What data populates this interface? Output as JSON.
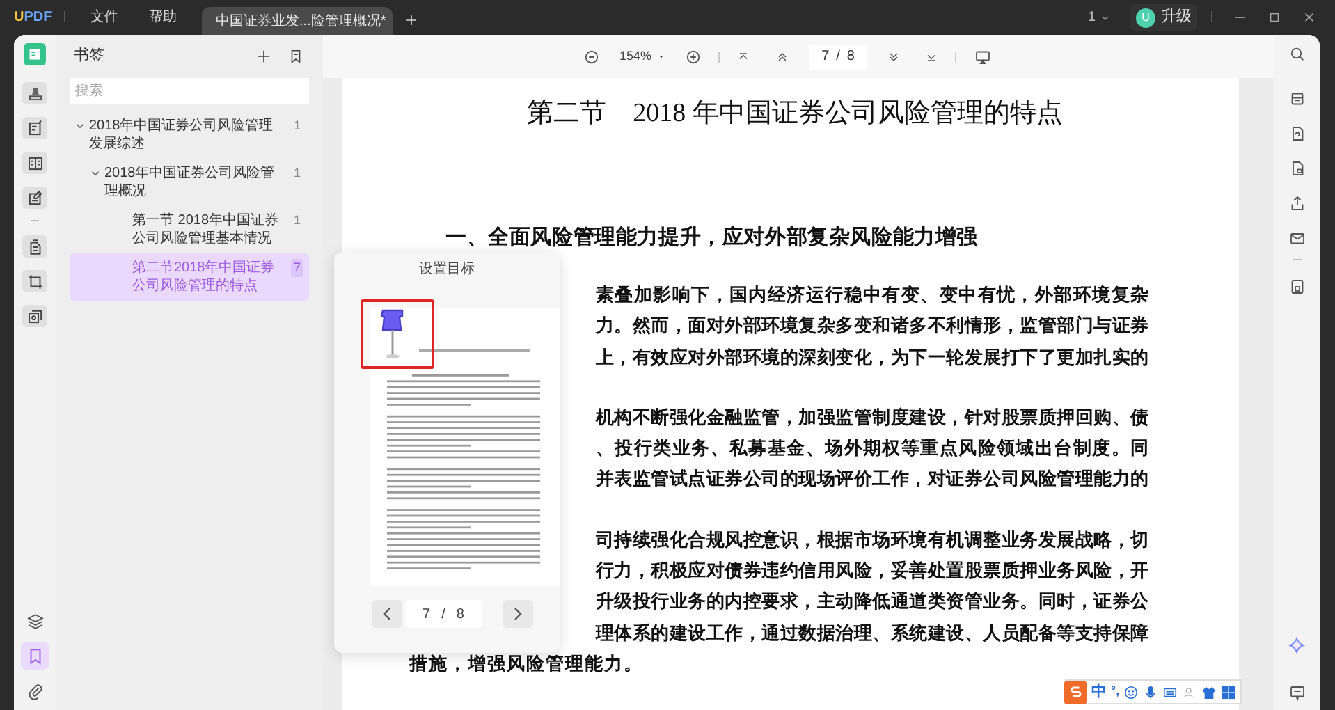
{
  "app": {
    "logo": "UPDF",
    "menu": [
      {
        "label": "文件"
      },
      {
        "label": "帮助"
      }
    ]
  },
  "tabs": [
    {
      "title": "中国证券业发...险管理概况*",
      "selected": true
    }
  ],
  "window_controls": {
    "page_count": "1",
    "upgrade": {
      "avatar": "U",
      "label": "升级"
    }
  },
  "toolbar": {
    "zoom": "154%",
    "page": {
      "current": "7",
      "separator": "/",
      "total": "8"
    }
  },
  "left_tools": [
    {
      "selected": false
    },
    {
      "selected": false
    },
    {
      "selected": false
    },
    {
      "selected": false
    },
    {
      "selected": false
    },
    {
      "selected": false
    },
    {
      "selected": false
    }
  ],
  "left_tools_bottom": [
    {
      "kind": "layers",
      "selected": false
    },
    {
      "kind": "bookmark",
      "selected": true
    },
    {
      "kind": "attachment",
      "selected": false
    }
  ],
  "sidebar": {
    "title": "书签",
    "search": {
      "placeholder": "搜索"
    },
    "bookmarks": [
      {
        "title": "2018年中国证券公司风险管理发展综述",
        "page": "1",
        "expanded": true,
        "selected": false,
        "children": [
          {
            "title": "2018年中国证券公司风险管理概况",
            "page": "1",
            "expanded": true,
            "selected": false,
            "children": [
              {
                "title": "第一节 2018年中国证券公司风险管理基本情况",
                "page": "1",
                "selected": false
              },
              {
                "title": "第二节2018年中国证券公司风险管理的特点",
                "page": "7",
                "selected": true
              }
            ]
          }
        ]
      }
    ]
  },
  "document": {
    "heading": "第二节　2018 年中国证券公司风险管理的特点",
    "section_heading": "一、全面风险管理能力提升，应对外部复杂风险能力增强",
    "paragraphs": [
      {
        "lines": [
          "素叠加影响下，国内经济运行稳中有变、变中有忧，外部环境复杂",
          "力。然而，面对外部环境复杂多变和诸多不利情形，监管部门与证券",
          "上，有效应对外部环境的深刻变化，为下一轮发展打下了更加扎实的"
        ]
      },
      {
        "lines": [
          "机构不断强化金融监管，加强监管制度建设，针对股票质押回购、债",
          "、投行类业务、私募基金、场外期权等重点风险领域出台制度。同",
          "并表监管试点证券公司的现场评价工作，对证券公司风险管理能力的"
        ]
      },
      {
        "lines": [
          "司持续强化合规风控意识，根据市场环境有机调整业务发展战略，切",
          "行力，积极应对债券违约信用风险，妥善处置股票质押业务风险，开",
          "升级投行业务的内控要求，主动降低通道类资管业务。同时，证券公",
          "理体系的建设工作，通过数据治理、系统建设、人员配备等支持保障"
        ]
      }
    ],
    "last_line": "措施，增强风险管理能力。"
  },
  "set_target_popup": {
    "title": "设置目标",
    "page": {
      "current": "7",
      "separator": "/",
      "total": "8"
    }
  },
  "ime_bar": {
    "mode": "中",
    "punctuation": "°,"
  }
}
